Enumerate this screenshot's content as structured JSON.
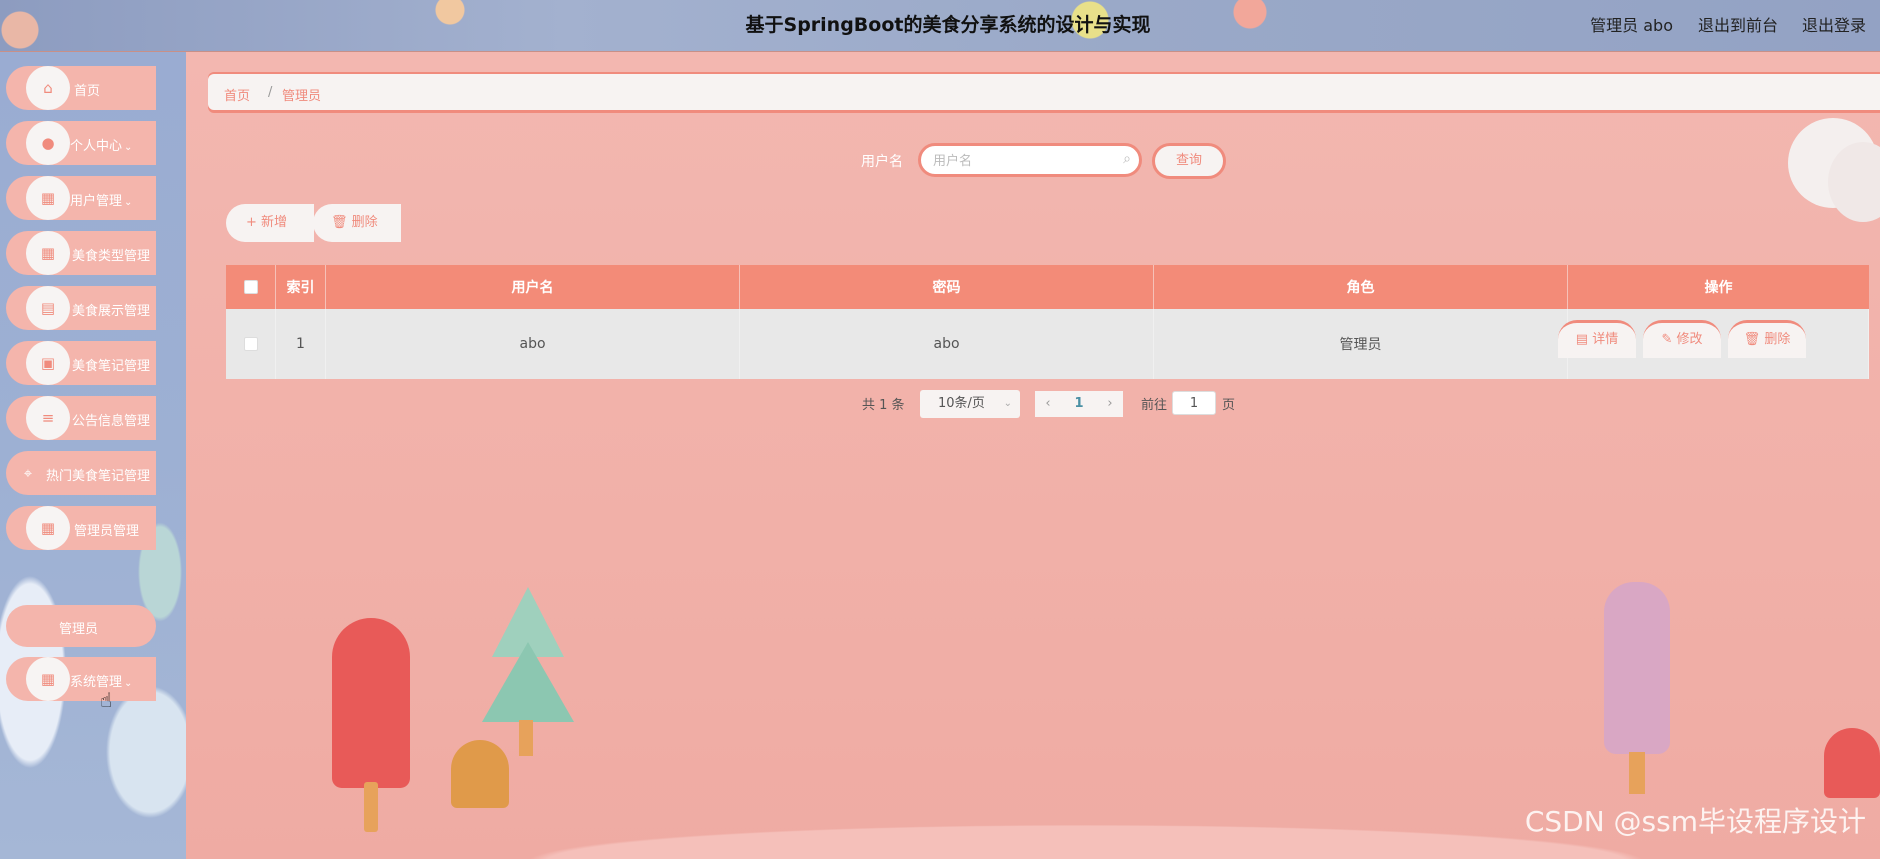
{
  "header": {
    "title": "基于SpringBoot的美食分享系统的设计与实现",
    "user": "管理员 abo",
    "front_link": "退出到前台",
    "logout_link": "退出登录"
  },
  "sidebar": {
    "items": [
      {
        "label": "首页",
        "icon": "home-icon"
      },
      {
        "label": "个人中心",
        "icon": "user-icon",
        "chevron": "⌄"
      },
      {
        "label": "用户管理",
        "icon": "grid-icon",
        "chevron": "⌄"
      },
      {
        "label": "美食类型管理",
        "icon": "grid-icon"
      },
      {
        "label": "美食展示管理",
        "icon": "clipboard-icon"
      },
      {
        "label": "美食笔记管理",
        "icon": "image-icon"
      },
      {
        "label": "公告信息管理",
        "icon": "list-icon"
      },
      {
        "label": "热门美食笔记管理",
        "icon": "location-icon"
      },
      {
        "label": "管理员管理",
        "icon": "grid-icon"
      },
      {
        "label": "系统管理",
        "icon": "grid-icon",
        "chevron": "⌄"
      }
    ],
    "submenu_label": "管理员"
  },
  "breadcrumb": {
    "home": "首页",
    "separator": "/",
    "current": "管理员"
  },
  "search": {
    "label": "用户名",
    "placeholder": "用户名",
    "value": "",
    "button": "查询"
  },
  "toolbar": {
    "add_label": "+ 新增",
    "delete_label": "删除"
  },
  "table": {
    "columns": [
      "索引",
      "用户名",
      "密码",
      "角色",
      "操作"
    ],
    "rows": [
      {
        "index": "1",
        "username": "abo",
        "password": "abo",
        "role": "管理员"
      }
    ],
    "actions": [
      "详情",
      "修改",
      "删除"
    ]
  },
  "pagination": {
    "total": "共 1 条",
    "page_size": "10条/页",
    "current_page": "1",
    "goto_label": "前往",
    "goto_value": "1",
    "page_suffix": "页"
  },
  "watermark": "CSDN @ssm毕设程序设计",
  "colors": {
    "accent": "#f08b7d",
    "header_row": "#f38b78",
    "background": "#f2b4ad",
    "sidebar": "#9aacd2"
  }
}
